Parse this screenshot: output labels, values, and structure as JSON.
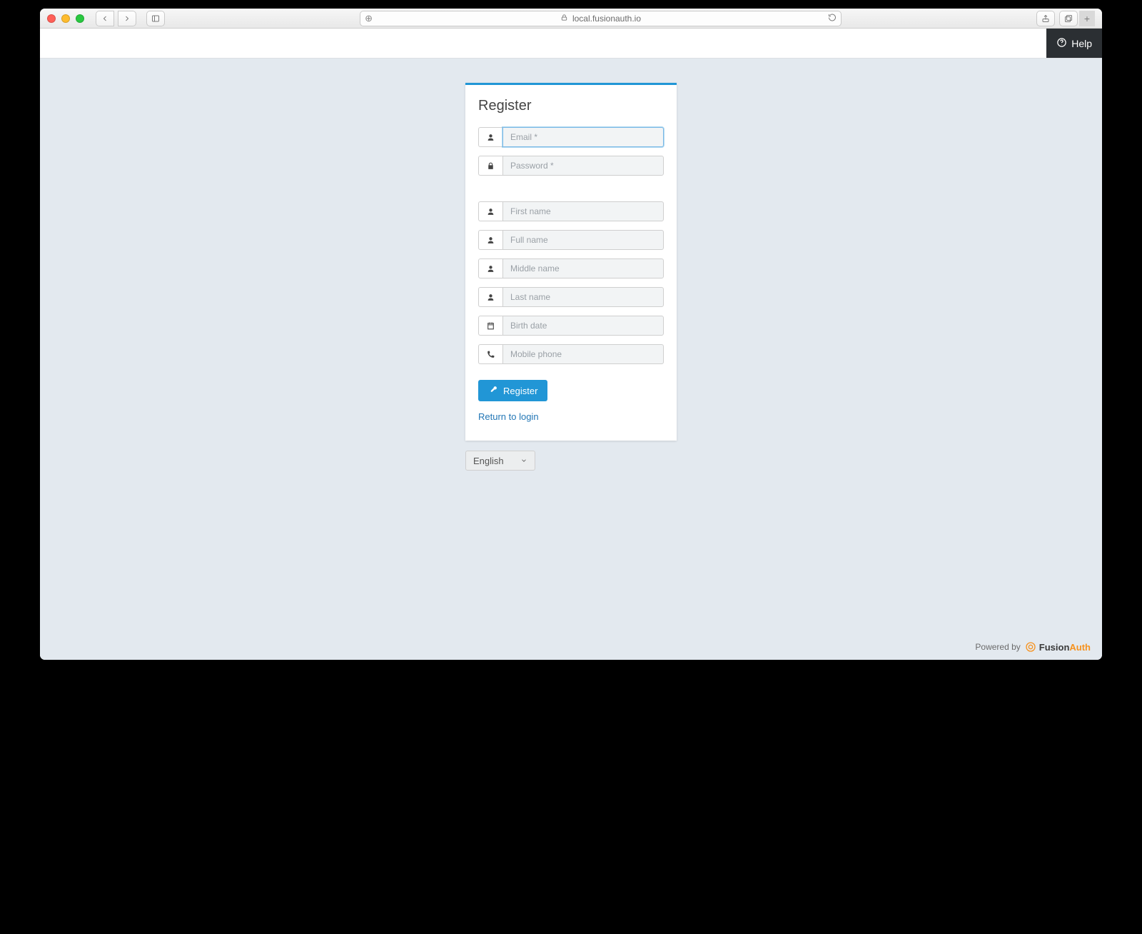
{
  "browser": {
    "url_host": "local.fusionauth.io"
  },
  "topbar": {
    "help_label": "Help"
  },
  "card": {
    "title": "Register",
    "fields": {
      "email_placeholder": "Email *",
      "password_placeholder": "Password *",
      "first_name_placeholder": "First name",
      "full_name_placeholder": "Full name",
      "middle_name_placeholder": "Middle name",
      "last_name_placeholder": "Last name",
      "birth_date_placeholder": "Birth date",
      "mobile_phone_placeholder": "Mobile phone"
    },
    "submit_label": "Register",
    "return_link_label": "Return to login"
  },
  "language": {
    "selected": "English"
  },
  "footer": {
    "powered_by": "Powered by",
    "brand_first": "Fusion",
    "brand_second": "Auth"
  }
}
